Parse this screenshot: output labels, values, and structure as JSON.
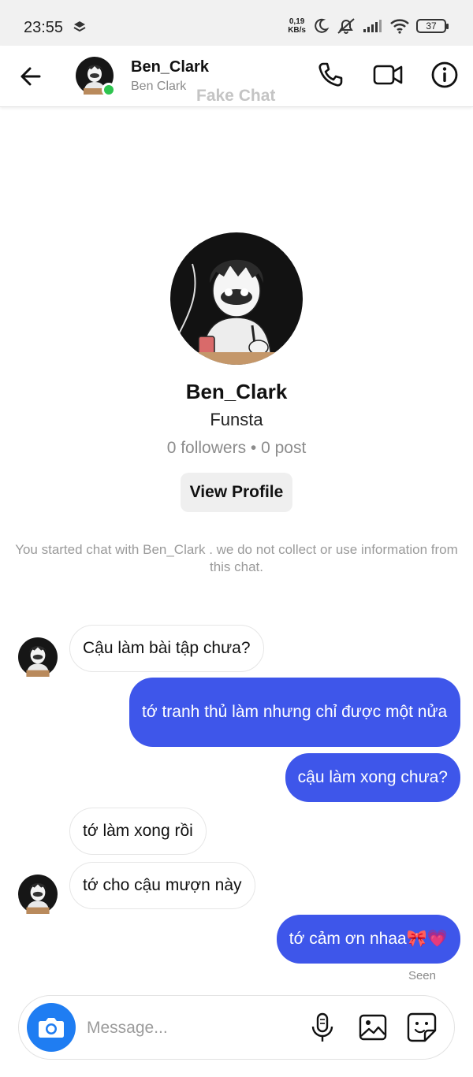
{
  "status_bar": {
    "time": "23:55",
    "net_speed_value": "0,19",
    "net_speed_unit": "KB/s",
    "battery": "37"
  },
  "header": {
    "name": "Ben_Clark",
    "subtitle": "Ben Clark",
    "watermark": "Fake Chat",
    "online": true
  },
  "profile": {
    "name": "Ben_Clark",
    "tagline": "Funsta",
    "stats": "0 followers • 0 post",
    "view_profile_label": "View Profile"
  },
  "notice": "You started chat with Ben_Clark . we do not collect or use information from this chat.",
  "messages": [
    {
      "side": "in",
      "text": "Cậu làm bài tập chưa?"
    },
    {
      "side": "out",
      "text": "tớ tranh thủ làm nhưng chỉ được một nửa"
    },
    {
      "side": "out",
      "text": "cậu làm xong chưa?"
    },
    {
      "side": "in",
      "text": "tớ làm xong rồi"
    },
    {
      "side": "in",
      "text": "tớ cho cậu mượn này"
    },
    {
      "side": "out",
      "text": "tớ cảm ơn nhaa🎀💗"
    }
  ],
  "seen_label": "Seen",
  "composer": {
    "placeholder": "Message..."
  },
  "colors": {
    "outgoing_bubble": "#3e56ea",
    "camera_button": "#1f7df2",
    "online": "#2ec44f"
  },
  "icons": [
    "back-arrow-icon",
    "phone-icon",
    "video-camera-icon",
    "info-icon",
    "camera-icon",
    "microphone-icon",
    "image-icon",
    "sticker-icon"
  ]
}
